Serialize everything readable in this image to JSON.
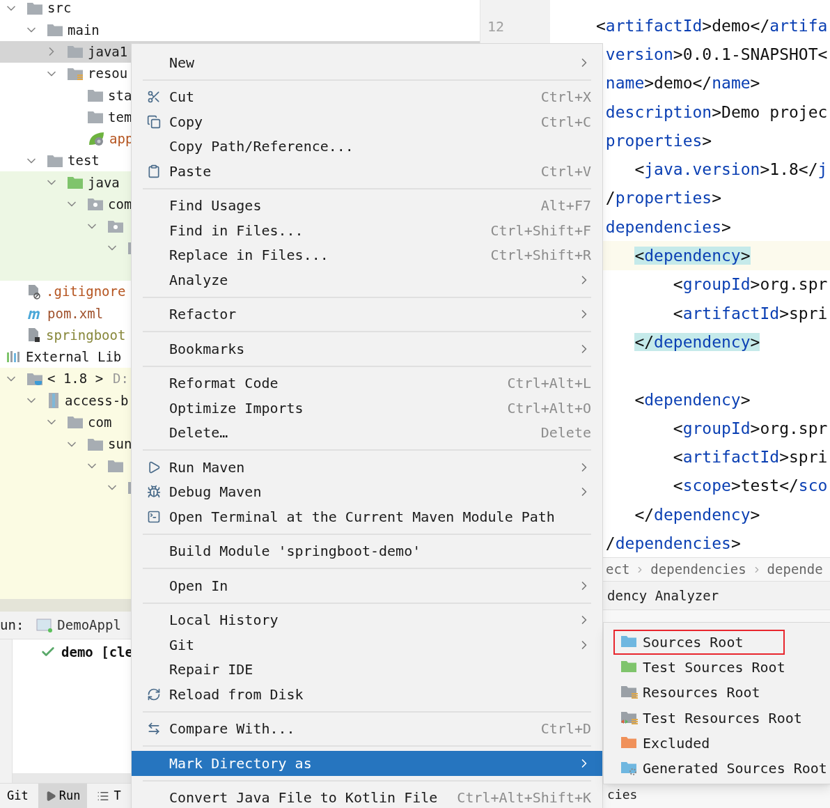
{
  "project_tree": [
    {
      "label": "src",
      "kind": "folder",
      "expanded": true,
      "children": [
        {
          "label": "main",
          "kind": "folder",
          "expanded": true,
          "children": [
            {
              "label": "java1",
              "kind": "folder",
              "expanded": false,
              "selected": true
            },
            {
              "label": "resou",
              "kind": "resources",
              "expanded": true,
              "children": [
                {
                  "label": "sta",
                  "kind": "folder"
                },
                {
                  "label": "tem",
                  "kind": "folder"
                },
                {
                  "label": "app",
                  "kind": "spring",
                  "color": "#b5541f"
                }
              ]
            }
          ]
        },
        {
          "label": "test",
          "kind": "folder",
          "expanded": true,
          "children": [
            {
              "label": "java",
              "kind": "test-folder",
              "expanded": true,
              "children": [
                {
                  "label": "com",
                  "kind": "package",
                  "expanded": true,
                  "children": [
                    {
                      "kind": "package",
                      "expanded": true,
                      "children": [
                        {
                          "kind": "folder",
                          "expanded": true
                        }
                      ]
                    }
                  ]
                }
              ]
            }
          ]
        }
      ]
    },
    {
      "label": ".gitignore",
      "kind": "gitignore",
      "color": "#b5541f"
    },
    {
      "label": "pom.xml",
      "kind": "maven",
      "color": "#a0522d"
    },
    {
      "label": "springboot",
      "kind": "script",
      "color": "#87873a"
    }
  ],
  "external_libraries": {
    "label": "External Lib",
    "kind": "libraries",
    "children": [
      {
        "label": "< 1.8 >",
        "path": "D:",
        "kind": "jdk",
        "expanded": true,
        "children": [
          {
            "label": "access-b",
            "kind": "jar",
            "expanded": true,
            "children": [
              {
                "label": "com",
                "kind": "folder",
                "expanded": true,
                "children": [
                  {
                    "label": "sun",
                    "kind": "folder",
                    "expanded": true,
                    "children": [
                      {
                        "kind": "folder",
                        "expanded": true,
                        "children": [
                          {
                            "kind": "folder",
                            "expanded": true
                          }
                        ]
                      }
                    ]
                  }
                ]
              }
            ]
          }
        ]
      }
    ]
  },
  "run_panel": {
    "label": "un:",
    "config": "DemoAppl",
    "result": "demo [cle"
  },
  "bottom_bar": [
    {
      "label": "Git",
      "selected": false
    },
    {
      "label": "Run",
      "selected": true,
      "kind": "run"
    },
    {
      "label": "T",
      "selected": false,
      "kind": "list"
    }
  ],
  "gutter": {
    "line_number": "12"
  },
  "code_lines": [
    {
      "kind": "code",
      "text": "<artifactId>demo</artifa",
      "current": false,
      "matched": false
    },
    {
      "kind": "code",
      "text": " version>0.0.1-SNAPSHOT<",
      "current": false,
      "matched": false
    },
    {
      "kind": "code",
      "text": " name>demo</name>",
      "current": false,
      "matched": false
    },
    {
      "kind": "code",
      "text": " description>Demo projec",
      "current": false,
      "matched": false
    },
    {
      "kind": "code",
      "text": " properties>",
      "current": false,
      "matched": false
    },
    {
      "kind": "code",
      "text": "    <java.version>1.8</j",
      "current": false,
      "matched": false
    },
    {
      "kind": "code",
      "text": " /properties>",
      "current": false,
      "matched": false
    },
    {
      "kind": "code",
      "text": " dependencies>",
      "current": false,
      "matched": false
    },
    {
      "kind": "code",
      "text": "    <dependency>",
      "current": true,
      "matched": true
    },
    {
      "kind": "code",
      "text": "        <groupId>org.spr",
      "current": false,
      "matched": false
    },
    {
      "kind": "code",
      "text": "        <artifactId>spri",
      "current": false,
      "matched": false
    },
    {
      "kind": "code",
      "text": "    </dependency>",
      "current": false,
      "matched": true
    },
    {
      "kind": "blank"
    },
    {
      "kind": "code",
      "text": "    <dependency>",
      "current": false,
      "matched": false
    },
    {
      "kind": "code",
      "text": "        <groupId>org.spr",
      "current": false,
      "matched": false
    },
    {
      "kind": "code",
      "text": "        <artifactId>spri",
      "current": false,
      "matched": false
    },
    {
      "kind": "code",
      "text": "        <scope>test</sco",
      "current": false,
      "matched": false
    },
    {
      "kind": "code",
      "text": "    </dependency>",
      "current": false,
      "matched": false
    },
    {
      "kind": "code",
      "text": " /dependencies>",
      "current": false,
      "matched": false
    }
  ],
  "breadcrumbs": [
    "ect",
    "dependencies",
    "depende"
  ],
  "tool_window": {
    "title": "dency Analyzer",
    "content": "cies"
  },
  "context_menu": [
    {
      "kind": "item",
      "label": "New",
      "submenu": true,
      "selected": false
    },
    {
      "kind": "separator"
    },
    {
      "kind": "scissors",
      "label": "Cut",
      "shortcut": "Ctrl+X",
      "selected": false
    },
    {
      "kind": "copy",
      "label": "Copy",
      "shortcut": "Ctrl+C",
      "selected": false
    },
    {
      "kind": "item",
      "label": "Copy Path/Reference...",
      "selected": false
    },
    {
      "kind": "paste",
      "label": "Paste",
      "shortcut": "Ctrl+V",
      "selected": false
    },
    {
      "kind": "separator"
    },
    {
      "kind": "item",
      "label": "Find Usages",
      "shortcut": "Alt+F7",
      "selected": false
    },
    {
      "kind": "item",
      "label": "Find in Files...",
      "shortcut": "Ctrl+Shift+F",
      "selected": false
    },
    {
      "kind": "item",
      "label": "Replace in Files...",
      "shortcut": "Ctrl+Shift+R",
      "selected": false
    },
    {
      "kind": "item",
      "label": "Analyze",
      "submenu": true,
      "selected": false
    },
    {
      "kind": "separator"
    },
    {
      "kind": "item",
      "label": "Refactor",
      "submenu": true,
      "selected": false
    },
    {
      "kind": "separator"
    },
    {
      "kind": "item",
      "label": "Bookmarks",
      "submenu": true,
      "selected": false
    },
    {
      "kind": "separator"
    },
    {
      "kind": "item",
      "label": "Reformat Code",
      "shortcut": "Ctrl+Alt+L",
      "selected": false
    },
    {
      "kind": "item",
      "label": "Optimize Imports",
      "shortcut": "Ctrl+Alt+O",
      "selected": false
    },
    {
      "kind": "item",
      "label": "Delete…",
      "shortcut": "Delete",
      "selected": false
    },
    {
      "kind": "separator"
    },
    {
      "kind": "maven-run",
      "label": "Run Maven",
      "submenu": true,
      "selected": false
    },
    {
      "kind": "maven-debug",
      "label": "Debug Maven",
      "submenu": true,
      "selected": false
    },
    {
      "kind": "terminal",
      "label": "Open Terminal at the Current Maven Module Path",
      "selected": false
    },
    {
      "kind": "separator"
    },
    {
      "kind": "item",
      "label": "Build Module 'springboot-demo'",
      "selected": false
    },
    {
      "kind": "separator"
    },
    {
      "kind": "item",
      "label": "Open In",
      "submenu": true,
      "selected": false
    },
    {
      "kind": "separator"
    },
    {
      "kind": "item",
      "label": "Local History",
      "submenu": true,
      "selected": false
    },
    {
      "kind": "item",
      "label": "Git",
      "submenu": true,
      "selected": false
    },
    {
      "kind": "item",
      "label": "Repair IDE",
      "selected": false
    },
    {
      "kind": "reload",
      "label": "Reload from Disk",
      "selected": false
    },
    {
      "kind": "separator"
    },
    {
      "kind": "compare",
      "label": "Compare With...",
      "shortcut": "Ctrl+D",
      "selected": false
    },
    {
      "kind": "separator"
    },
    {
      "kind": "item",
      "label": "Mark Directory as",
      "submenu": true,
      "selected": true
    },
    {
      "kind": "separator"
    },
    {
      "kind": "item",
      "label": "Convert Java File to Kotlin File",
      "shortcut": "Ctrl+Alt+Shift+K",
      "selected": false
    }
  ],
  "submenu": [
    {
      "label": "Sources Root",
      "kind": "plain",
      "color": "#6fb7e0",
      "outlined": true
    },
    {
      "label": "Test Sources Root",
      "kind": "plain",
      "color": "#7fc46c",
      "outlined": false
    },
    {
      "label": "Resources Root",
      "kind": "resources",
      "color": "#9aa0a6",
      "outlined": false
    },
    {
      "label": "Test Resources Root",
      "kind": "test-resources",
      "color": "#9aa0a6",
      "outlined": false
    },
    {
      "label": "Excluded",
      "kind": "plain",
      "color": "#f0915a",
      "outlined": false
    },
    {
      "label": "Generated Sources Root",
      "kind": "generated",
      "color": "#6fb7e0",
      "outlined": false
    }
  ]
}
